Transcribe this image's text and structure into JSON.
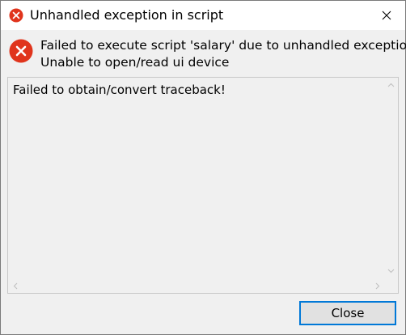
{
  "window": {
    "title": "Unhandled exception in script",
    "title_icon": "error-icon",
    "close_icon": "close-icon"
  },
  "message": {
    "icon": "error-icon",
    "line1": "Failed to execute script 'salary' due to unhandled exception:",
    "line2": "Unable to open/read ui device"
  },
  "traceback": {
    "text": "Failed to obtain/convert traceback!"
  },
  "buttons": {
    "close_label": "Close"
  },
  "colors": {
    "error_red": "#e81123",
    "focus_blue": "#0078d7",
    "window_bg": "#f0f0f0"
  }
}
